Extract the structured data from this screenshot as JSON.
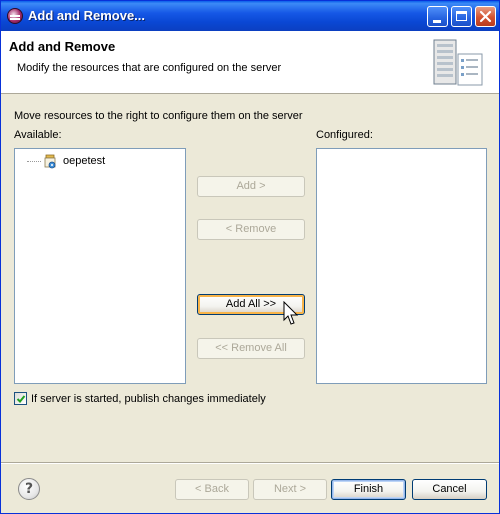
{
  "window": {
    "title": "Add and Remove..."
  },
  "header": {
    "title": "Add and Remove",
    "description": "Modify the resources that are configured on the server",
    "icon": "server-icon"
  },
  "body": {
    "instruction": "Move resources to the right to configure them on the server",
    "available_label": "Available:",
    "configured_label": "Configured:",
    "available_items": [
      {
        "label": "oepetest",
        "icon": "project-icon"
      }
    ],
    "configured_items": []
  },
  "buttons": {
    "add": "Add >",
    "remove": "< Remove",
    "add_all": "Add All >>",
    "remove_all": "<< Remove All",
    "back": "< Back",
    "next": "Next >",
    "finish": "Finish",
    "cancel": "Cancel"
  },
  "options": {
    "publish_label": "If server is started, publish changes immediately",
    "publish_checked": true
  },
  "colors": {
    "title_bar": "#0a47d4",
    "dialog_bg": "#ece9d8",
    "disabled_text": "#aca899",
    "hover_highlight": "#f8b449"
  }
}
